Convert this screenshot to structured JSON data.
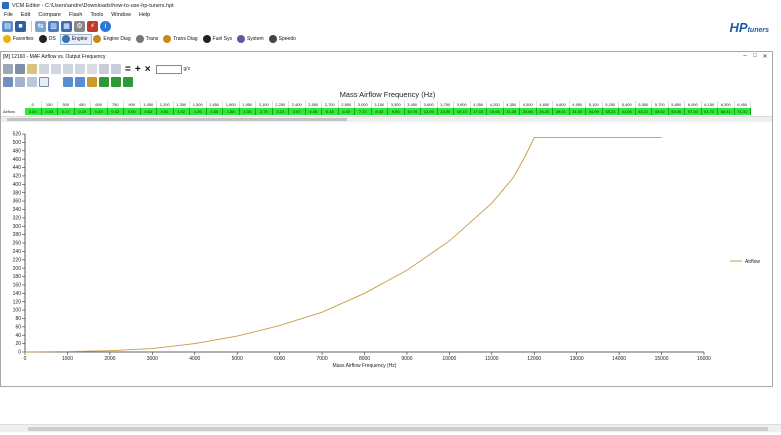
{
  "window": {
    "title": "VCM Editor - C:\\Users\\andre\\Downloads\\how-to-use-hp-tuners.hpt"
  },
  "menu": [
    "File",
    "Edit",
    "Compare",
    "Flash",
    "Tools",
    "Window",
    "Help"
  ],
  "toolbar_icons": [
    "open-icon",
    "save-icon",
    "compare-icon",
    "read-icon",
    "write-icon",
    "connect-icon",
    "flash-icon",
    "info-icon"
  ],
  "brand": {
    "hp": "HP",
    "tuners": "tuners"
  },
  "nav_tabs": [
    {
      "label": "Favorites",
      "icon": "star-icon",
      "color": "#e7b416"
    },
    {
      "label": "OS",
      "icon": "chip-icon",
      "color": "#222222"
    },
    {
      "label": "Engine",
      "icon": "engine-icon",
      "color": "#3b6fb6",
      "active": true
    },
    {
      "label": "Engine Diag",
      "icon": "engine-diag-icon",
      "color": "#c58a1a"
    },
    {
      "label": "Trans",
      "icon": "gear-icon",
      "color": "#777777"
    },
    {
      "label": "Trans Diag",
      "icon": "trans-diag-icon",
      "color": "#c58a1a"
    },
    {
      "label": "Fuel Sys",
      "icon": "fuel-icon",
      "color": "#222222"
    },
    {
      "label": "System",
      "icon": "system-icon",
      "color": "#5a5a9e"
    },
    {
      "label": "Speedo",
      "icon": "speedo-icon",
      "color": "#444444"
    }
  ],
  "inner_window": {
    "title": "[M] 12160 - MAF Airflow vs. Output Frequency",
    "table_title": "Mass Airflow Frequency (Hz)",
    "row_label": "Airflow",
    "pct_label": "g/s",
    "columns": [
      "0",
      "150",
      "300",
      "450",
      "600",
      "750",
      "900",
      "1,050",
      "1,200",
      "1,350",
      "1,500",
      "1,650",
      "1,800",
      "1,950",
      "2,100",
      "2,250",
      "2,400",
      "2,550",
      "2,700",
      "2,850",
      "3,000",
      "3,150",
      "3,300",
      "3,450",
      "3,600",
      "3,750",
      "3,900",
      "4,050",
      "4,200",
      "4,350",
      "4,500",
      "4,650",
      "4,800",
      "4,950",
      "5,100",
      "5,250",
      "5,400",
      "5,550",
      "5,700",
      "5,850",
      "6,000",
      "6,150",
      "6,300",
      "6,450"
    ],
    "values": [
      "0.00",
      "0.05",
      "0.17",
      "0.25",
      "0.33",
      "0.42",
      "0.50",
      "0.62",
      "0.81",
      "1.02",
      "1.26",
      "1.55",
      "1.88",
      "2.30",
      "2.75",
      "3.23",
      "3.87",
      "4.48",
      "5.18",
      "6.40",
      "7.37",
      "8.43",
      "9.50",
      "10.78",
      "12.09",
      "13.55",
      "15.13",
      "17.03",
      "19.06",
      "21.26",
      "23.66",
      "26.20",
      "29.01",
      "31.92",
      "34.99",
      "38.23",
      "41.60",
      "45.21",
      "49.02",
      "53.06",
      "57.20",
      "61.72",
      "66.41",
      "71.31"
    ]
  },
  "chart_data": {
    "type": "line",
    "title": "",
    "xlabel": "Mass Airflow Frequency (Hz)",
    "ylabel": "",
    "xlim": [
      0,
      16000
    ],
    "ylim": [
      0,
      520
    ],
    "x_ticks": [
      0,
      1000,
      2000,
      3000,
      4000,
      5000,
      6000,
      7000,
      8000,
      9000,
      10000,
      11000,
      12000,
      13000,
      14000,
      15000,
      16000
    ],
    "y_ticks": [
      0,
      20,
      40,
      60,
      80,
      100,
      120,
      140,
      160,
      180,
      200,
      220,
      240,
      260,
      280,
      300,
      320,
      340,
      360,
      380,
      400,
      420,
      440,
      460,
      480,
      500,
      520
    ],
    "legend_position": "right",
    "series": [
      {
        "name": "Airflow",
        "color": "#c99a45",
        "x": [
          0,
          1000,
          2000,
          3000,
          4000,
          5000,
          6000,
          7000,
          8000,
          9000,
          10000,
          11000,
          11500,
          11800,
          12000,
          13000,
          14000,
          15000
        ],
        "values": [
          0,
          1,
          3,
          8,
          20,
          38,
          63,
          95,
          140,
          195,
          265,
          355,
          415,
          470,
          512,
          512,
          512,
          512
        ]
      }
    ]
  }
}
